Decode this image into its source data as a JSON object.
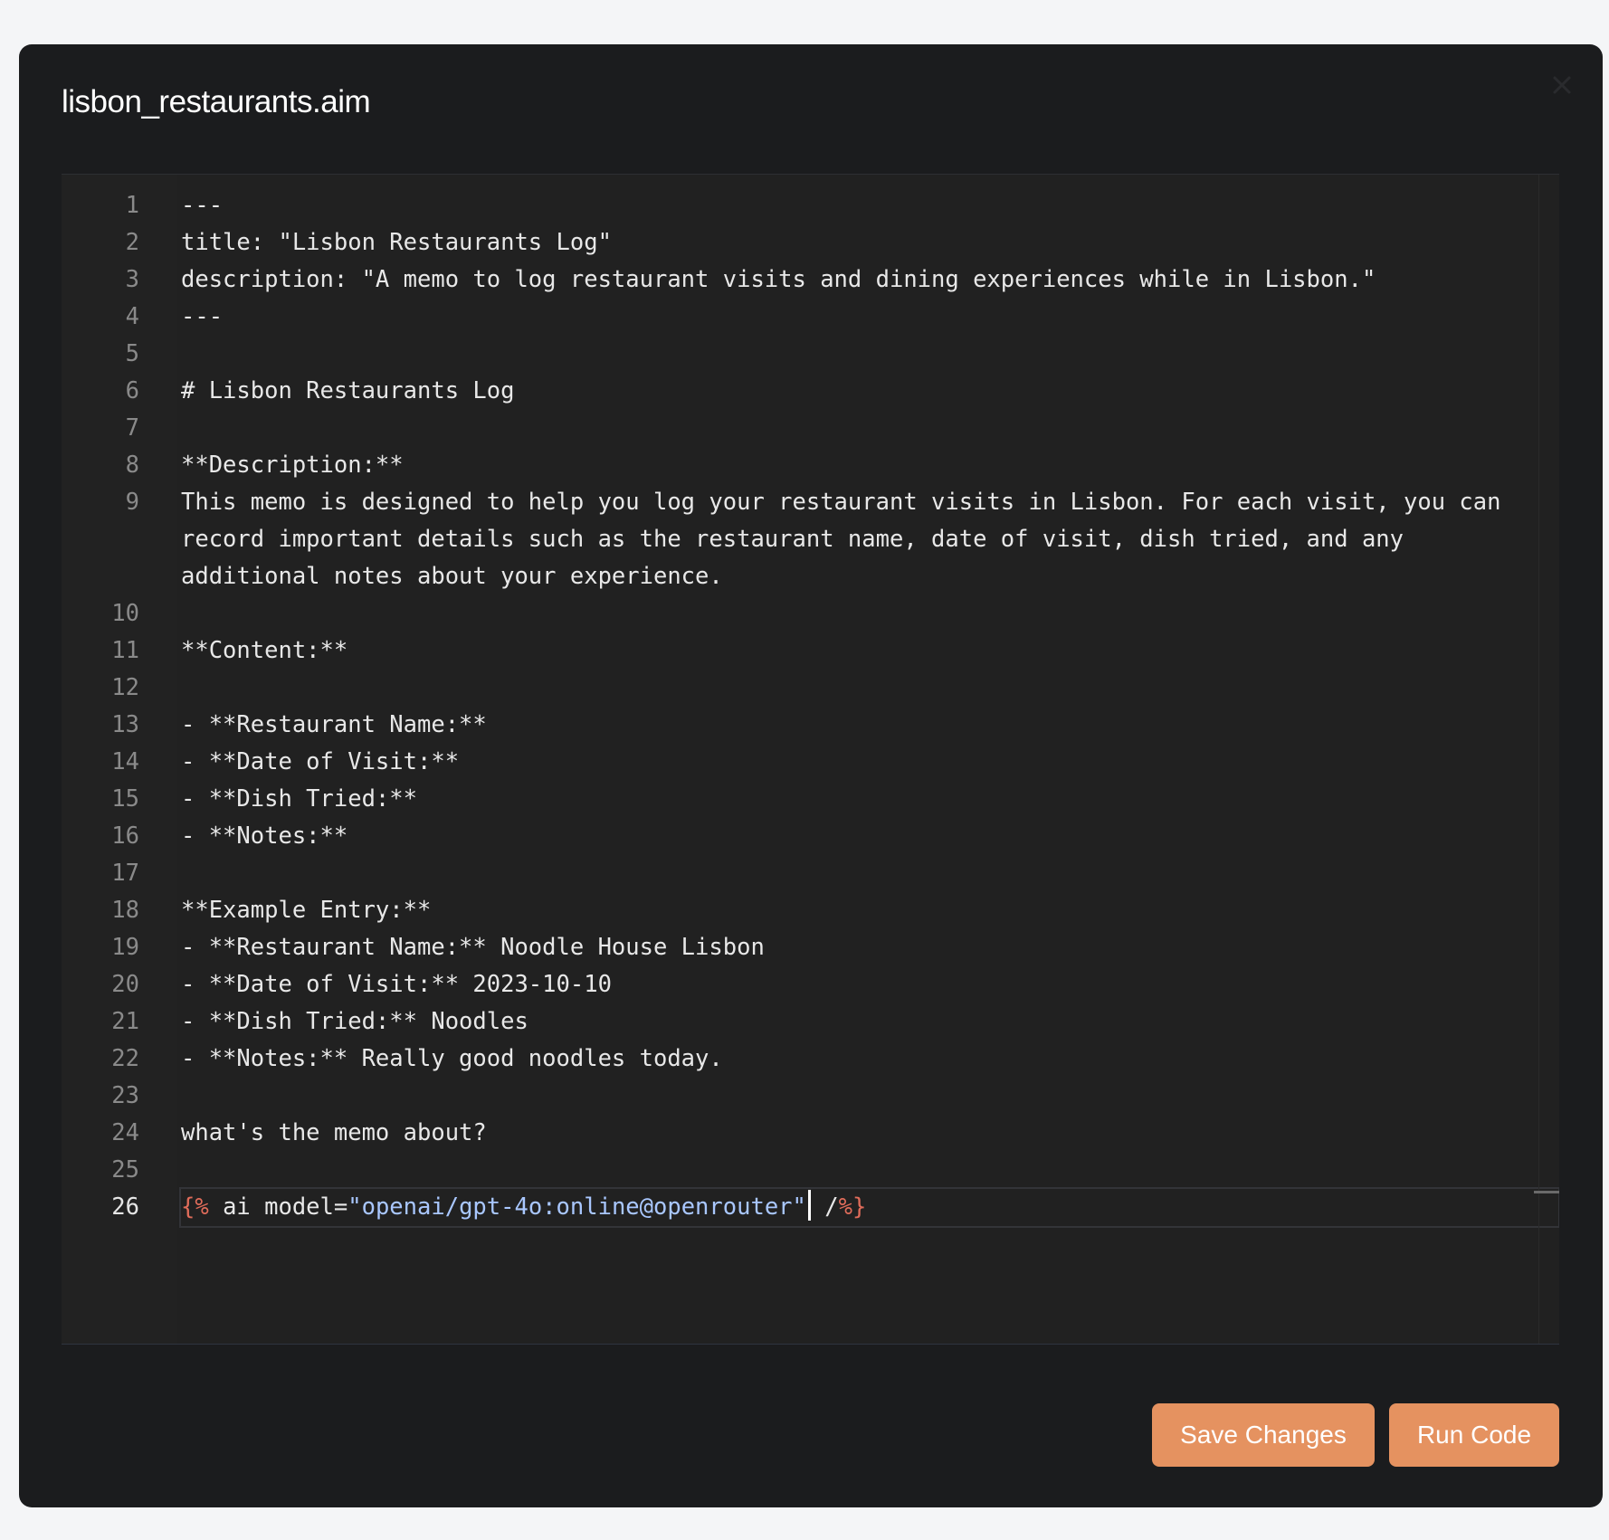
{
  "modal": {
    "title": "lisbon_restaurants.aim",
    "close_icon": "close-icon"
  },
  "editor": {
    "active_line": 26,
    "lines": [
      {
        "n": "1",
        "text": "---"
      },
      {
        "n": "2",
        "text": "title: \"Lisbon Restaurants Log\""
      },
      {
        "n": "3",
        "text": "description: \"A memo to log restaurant visits and dining experiences while in Lisbon.\""
      },
      {
        "n": "4",
        "text": "---"
      },
      {
        "n": "5",
        "text": ""
      },
      {
        "n": "6",
        "text": "# Lisbon Restaurants Log"
      },
      {
        "n": "7",
        "text": ""
      },
      {
        "n": "8",
        "text": "**Description:**"
      },
      {
        "n": "9",
        "text": "This memo is designed to help you log your restaurant visits in Lisbon. For each visit, you can record important details such as the restaurant name, date of visit, dish tried, and any additional notes about your experience."
      },
      {
        "n": "10",
        "text": ""
      },
      {
        "n": "11",
        "text": "**Content:**"
      },
      {
        "n": "12",
        "text": ""
      },
      {
        "n": "13",
        "text": "- **Restaurant Name:**"
      },
      {
        "n": "14",
        "text": "- **Date of Visit:**"
      },
      {
        "n": "15",
        "text": "- **Dish Tried:**"
      },
      {
        "n": "16",
        "text": "- **Notes:**"
      },
      {
        "n": "17",
        "text": ""
      },
      {
        "n": "18",
        "text": "**Example Entry:**"
      },
      {
        "n": "19",
        "text": "- **Restaurant Name:** Noodle House Lisbon"
      },
      {
        "n": "20",
        "text": "- **Date of Visit:** 2023-10-10"
      },
      {
        "n": "21",
        "text": "- **Dish Tried:** Noodles"
      },
      {
        "n": "22",
        "text": "- **Notes:** Really good noodles today."
      },
      {
        "n": "23",
        "text": ""
      },
      {
        "n": "24",
        "text": "what's the memo about?"
      },
      {
        "n": "25",
        "text": ""
      }
    ],
    "last_line": {
      "n": "26",
      "tag_open": "{%",
      "mid": " ai model=",
      "string": "\"openai/gpt-4o:online@openrouter\"",
      "space": " /",
      "tag_close": "%}"
    },
    "colors": {
      "background": "#212121",
      "tag": "#e06c5a",
      "string": "#a9c7ff"
    }
  },
  "actions": {
    "save_label": "Save Changes",
    "run_label": "Run Code",
    "button_color": "#e59260"
  }
}
